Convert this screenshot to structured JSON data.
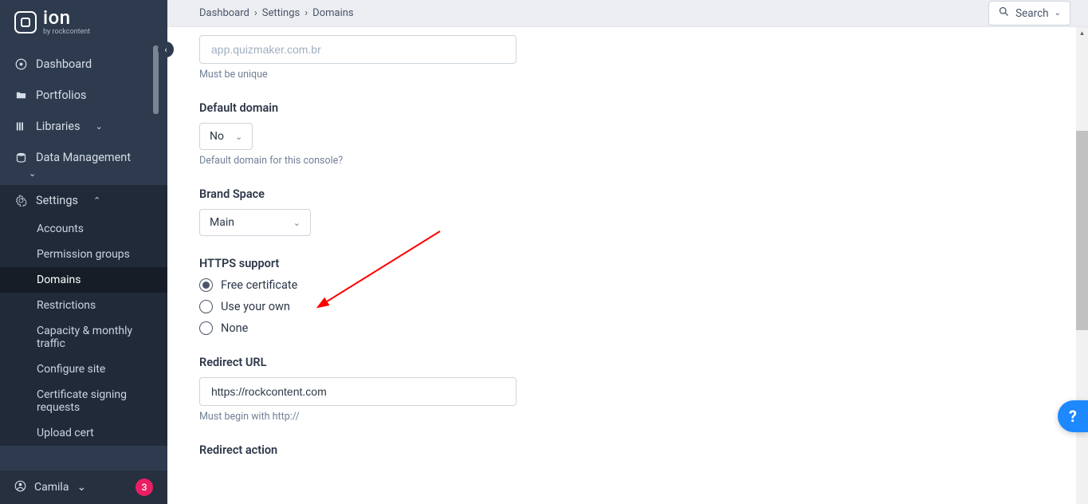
{
  "brand": {
    "name": "ion",
    "byline": "by rockcontent"
  },
  "sidebar": {
    "items": [
      {
        "label": "Dashboard",
        "icon": "dashboard"
      },
      {
        "label": "Portfolios",
        "icon": "folder"
      },
      {
        "label": "Libraries",
        "icon": "library",
        "expandable": true
      },
      {
        "label": "Data Management",
        "icon": "database",
        "expandable": true
      },
      {
        "label": "Settings",
        "icon": "gear",
        "expandable": true,
        "open": true
      }
    ],
    "settings_sub": [
      {
        "label": "Accounts"
      },
      {
        "label": "Permission groups"
      },
      {
        "label": "Domains",
        "active": true
      },
      {
        "label": "Restrictions"
      },
      {
        "label": "Capacity & monthly traffic"
      },
      {
        "label": "Configure site"
      },
      {
        "label": "Certificate signing requests"
      },
      {
        "label": "Upload cert"
      }
    ]
  },
  "user": {
    "name": "Camila",
    "notifications": "3"
  },
  "breadcrumb": {
    "a": "Dashboard",
    "b": "Settings",
    "c": "Domains"
  },
  "search": {
    "label": "Search"
  },
  "form": {
    "domain_placeholder": "app.quizmaker.com.br",
    "domain_helper": "Must be unique",
    "default_domain_label": "Default domain",
    "default_domain_value": "No",
    "default_domain_helper": "Default domain for this console?",
    "brand_space_label": "Brand Space",
    "brand_space_value": "Main",
    "https_label": "HTTPS support",
    "https_options": {
      "free": "Free certificate",
      "own": "Use your own",
      "none": "None"
    },
    "redirect_url_label": "Redirect URL",
    "redirect_url_value": "https://rockcontent.com",
    "redirect_url_helper": "Must begin with http://",
    "redirect_action_label": "Redirect action"
  },
  "help": "?"
}
